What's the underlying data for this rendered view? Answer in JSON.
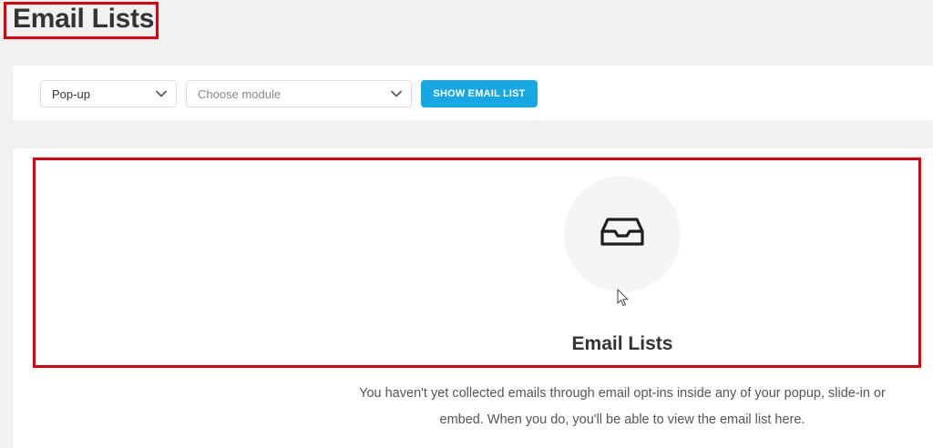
{
  "page": {
    "title": "Email Lists"
  },
  "filters": {
    "module_type": {
      "selected": "Pop-up",
      "icon": "chevron-down-icon"
    },
    "module": {
      "placeholder": "Choose module",
      "icon": "chevron-down-icon"
    },
    "show_button_label": "SHOW EMAIL LIST"
  },
  "empty_state": {
    "icon": "inbox-icon",
    "title": "Email Lists",
    "description": "You haven't yet collected emails through email opt-ins inside any of your popup, slide-in or embed. When you do, you'll be able to view the email list here."
  },
  "colors": {
    "accent": "#17a8e3",
    "highlight": "#e3000b",
    "background": "#f1f1f1",
    "card": "#ffffff"
  }
}
